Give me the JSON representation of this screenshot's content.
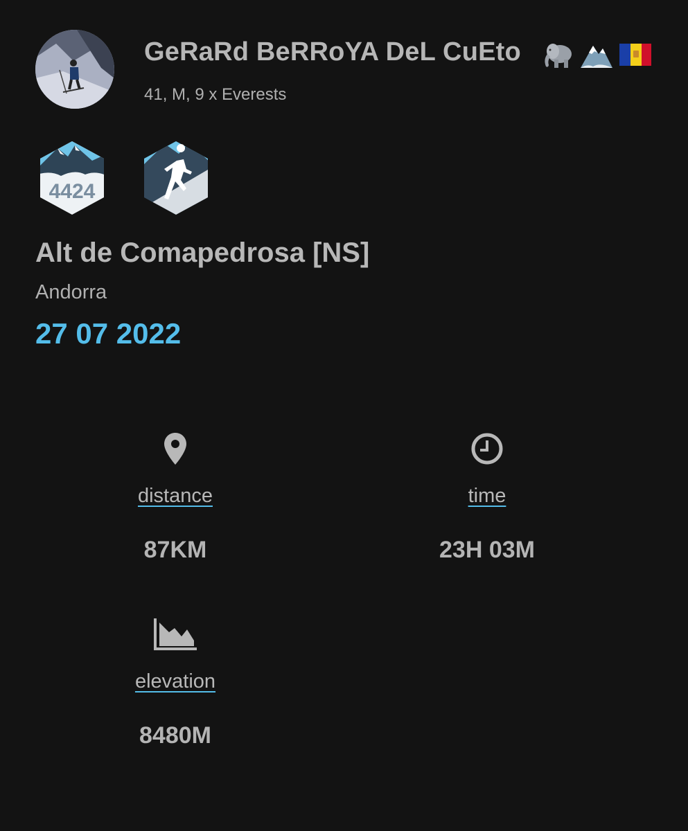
{
  "profile": {
    "name": "GeRaRd BeRRoYA DeL CuEto",
    "name_emojis": [
      "elephant-icon",
      "snow-mountain-icon",
      "andorra-flag-icon"
    ],
    "meta": "41, M, 9 x Everests"
  },
  "badges": [
    {
      "icon": "mountain-4424-badge-icon",
      "text": "4424"
    },
    {
      "icon": "runner-mountain-badge-icon"
    }
  ],
  "peak": {
    "name": "Alt de Comapedrosa [NS]",
    "country": "Andorra",
    "date": "27 07 2022"
  },
  "stats": {
    "distance": {
      "icon": "location-pin-icon",
      "label": "distance",
      "value": "87KM"
    },
    "time": {
      "icon": "clock-icon",
      "label": "time",
      "value": "23H 03M"
    },
    "elevation": {
      "icon": "area-chart-icon",
      "label": "elevation",
      "value": "8480M"
    }
  },
  "colors": {
    "background": "#131313",
    "accent": "#54bdea",
    "text": "#b8b8b8"
  }
}
